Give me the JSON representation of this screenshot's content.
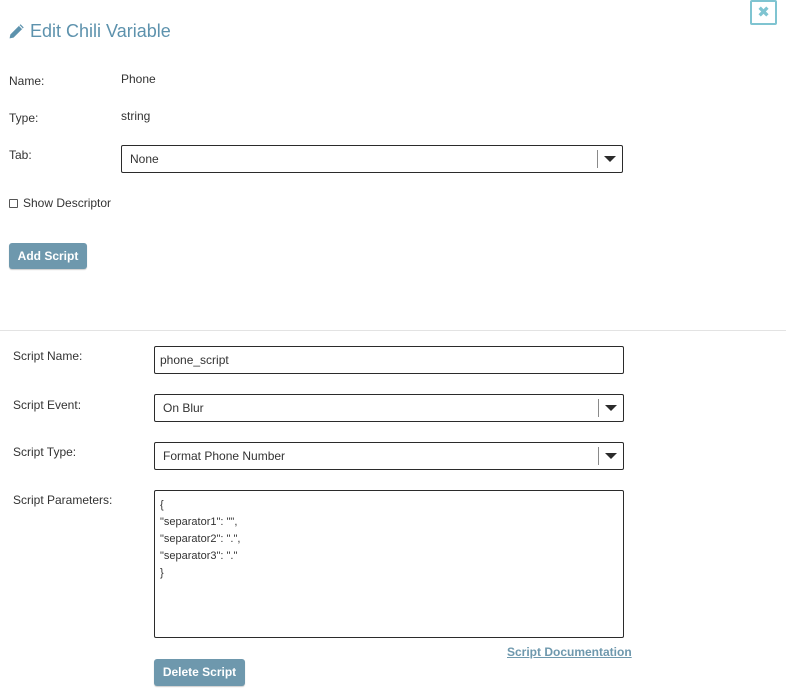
{
  "dialog": {
    "title": "Edit Chili Variable",
    "close_label": "✖"
  },
  "variable": {
    "name_label": "Name:",
    "name_value": "Phone",
    "type_label": "Type:",
    "type_value": "string",
    "tab_label": "Tab:",
    "tab_selected": "None",
    "show_descriptor_label": "Show Descriptor",
    "show_descriptor_checked": false,
    "add_script_label": "Add Script"
  },
  "script": {
    "name_label": "Script Name:",
    "name_value": "phone_script",
    "event_label": "Script Event:",
    "event_selected": "On Blur",
    "type_label": "Script Type:",
    "type_selected": "Format Phone Number",
    "parameters_label": "Script Parameters:",
    "parameters_lines": [
      "{",
      "\"separator1\": \"\",",
      "\"separator2\": \".\",",
      "\"separator3\": \".\"",
      "}"
    ],
    "documentation_link": "Script Documentation",
    "delete_label": "Delete Script"
  },
  "icons": {
    "title_icon": "pencil-icon",
    "close_icon": "close-icon",
    "dropdown_icon": "chevron-down-icon"
  },
  "colors": {
    "accent": "#5d92ad",
    "button_bg": "#6e98ad",
    "close_border": "#7fc4d1"
  }
}
